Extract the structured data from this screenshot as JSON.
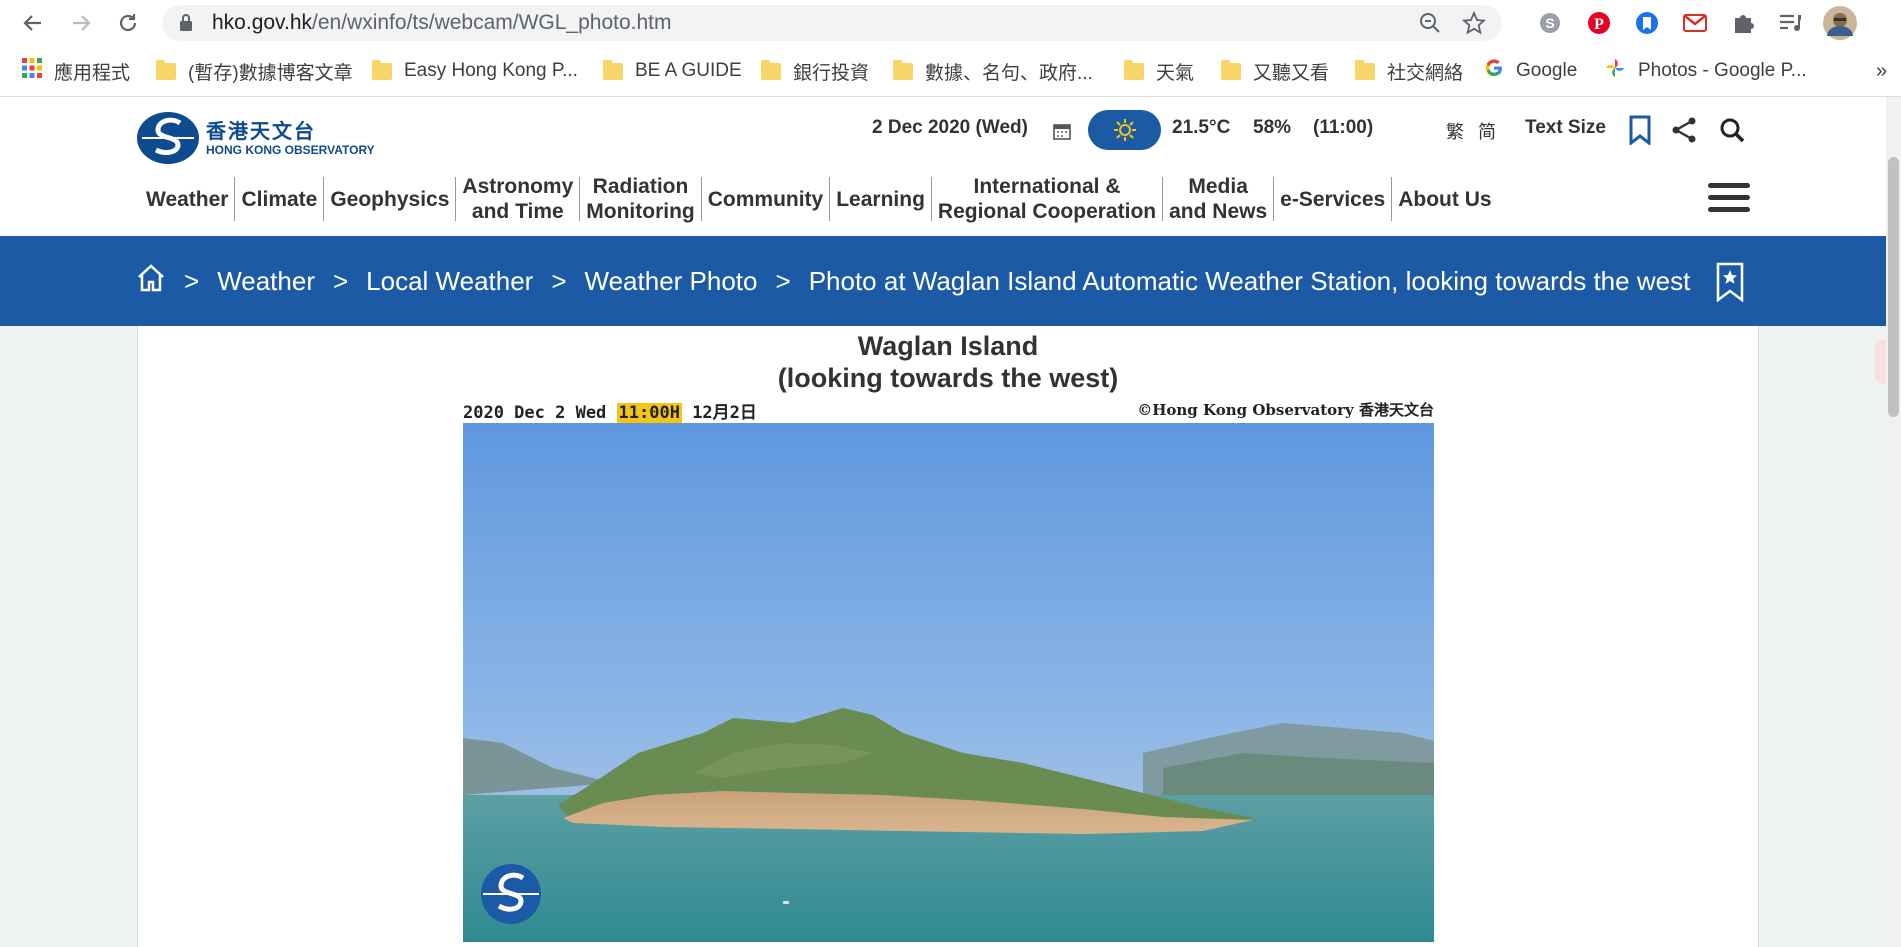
{
  "browser": {
    "url_host": "hko.gov.hk",
    "url_path": "/en/wxinfo/ts/webcam/WGL_photo.htm",
    "bookmarks": [
      {
        "label": "應用程式",
        "icon": "apps-grid-icon"
      },
      {
        "label": "(暫存)數據博客文章",
        "icon": "folder-icon"
      },
      {
        "label": "Easy Hong Kong P...",
        "icon": "folder-icon"
      },
      {
        "label": "BE A GUIDE",
        "icon": "folder-icon"
      },
      {
        "label": "銀行投資",
        "icon": "folder-icon"
      },
      {
        "label": "數據、名句、政府...",
        "icon": "folder-icon"
      },
      {
        "label": "天氣",
        "icon": "folder-icon"
      },
      {
        "label": "又聽又看",
        "icon": "folder-icon"
      },
      {
        "label": "社交網絡",
        "icon": "folder-icon"
      },
      {
        "label": "Google",
        "icon": "google-icon"
      },
      {
        "label": "Photos - Google P...",
        "icon": "google-photos-icon"
      }
    ]
  },
  "header": {
    "logo_zh": "香港天文台",
    "logo_en": "HONG KONG OBSERVATORY",
    "date": "2 Dec 2020 (Wed)",
    "temperature": "21.5°C",
    "humidity": "58%",
    "time": "(11:00)",
    "lang_trad": "繁",
    "lang_simp": "简",
    "text_size": "Text Size"
  },
  "nav": {
    "items": [
      {
        "line1": "Weather",
        "line2": ""
      },
      {
        "line1": "Climate",
        "line2": ""
      },
      {
        "line1": "Geophysics",
        "line2": ""
      },
      {
        "line1": "Astronomy",
        "line2": "and Time"
      },
      {
        "line1": "Radiation",
        "line2": "Monitoring"
      },
      {
        "line1": "Community",
        "line2": ""
      },
      {
        "line1": "Learning",
        "line2": ""
      },
      {
        "line1": "International &",
        "line2": "Regional Cooperation"
      },
      {
        "line1": "Media",
        "line2": "and News"
      },
      {
        "line1": "e-Services",
        "line2": ""
      },
      {
        "line1": "About Us",
        "line2": ""
      }
    ]
  },
  "breadcrumb": {
    "sep": ">",
    "items": [
      "Weather",
      "Local Weather",
      "Weather Photo",
      "Photo at Waglan Island Automatic Weather Station, looking towards the west"
    ]
  },
  "photo": {
    "title_line1": "Waglan Island",
    "title_line2": "(looking towards the west)",
    "stamp_date": "2020 Dec 2 Wed ",
    "stamp_time": "11:00H",
    "stamp_zh_date": " 12月2日",
    "stamp_copyright": "©Hong Kong Observatory 香港天文台"
  },
  "colors": {
    "brand_blue": "#1c5aa6",
    "time_highlight": "#f4c515"
  }
}
